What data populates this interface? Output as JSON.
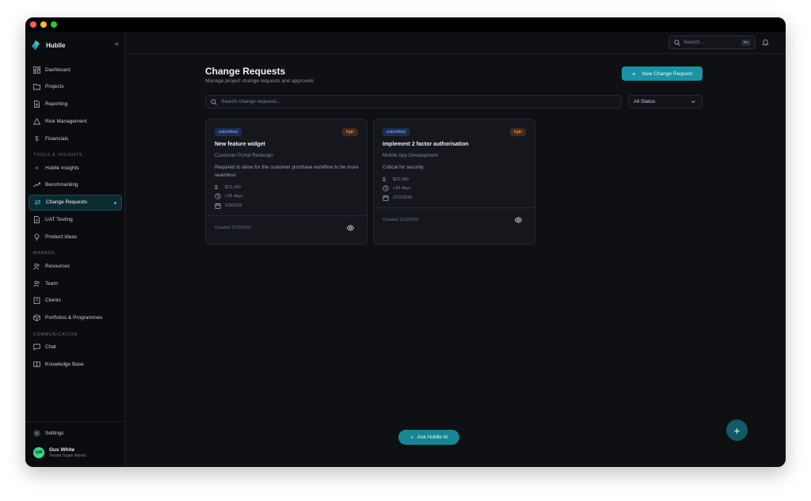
{
  "brand": {
    "name": "Hublle",
    "collapse_icon": "double-chevron-left-icon"
  },
  "sidebar": {
    "main_items": [
      {
        "label": "Dashboard",
        "icon": "layout-grid-icon"
      },
      {
        "label": "Projects",
        "icon": "folder-icon"
      },
      {
        "label": "Reporting",
        "icon": "file-text-icon"
      },
      {
        "label": "Risk Management",
        "icon": "alert-triangle-icon"
      },
      {
        "label": "Financials",
        "icon": "dollar-icon"
      }
    ],
    "tools_label": "TOOLS & INSIGHTS",
    "tools_items": [
      {
        "label": "Hublle Insights",
        "icon": "sparkles-icon"
      },
      {
        "label": "Benchmarking",
        "icon": "trending-up-icon"
      },
      {
        "label": "Change Requests",
        "icon": "arrows-swap-icon",
        "active": true
      },
      {
        "label": "UAT Testing",
        "icon": "file-check-icon"
      },
      {
        "label": "Product Ideas",
        "icon": "lightbulb-icon"
      }
    ],
    "manage_label": "MANAGE",
    "manage_items": [
      {
        "label": "Resources",
        "icon": "users-icon"
      },
      {
        "label": "Team",
        "icon": "users-icon"
      },
      {
        "label": "Clients",
        "icon": "building-icon"
      },
      {
        "label": "Portfolios & Programmes",
        "icon": "package-icon"
      }
    ],
    "communication_label": "COMMUNICATION",
    "communication_items": [
      {
        "label": "Chat",
        "icon": "message-icon"
      },
      {
        "label": "Knowledge Base",
        "icon": "book-icon"
      }
    ],
    "settings_label": "Settings",
    "user": {
      "initials": "GW",
      "name": "Gus White",
      "role": "Tenant Super Admin"
    }
  },
  "topbar": {
    "search_placeholder": "Search...",
    "shortcut": "⌘K"
  },
  "page": {
    "title": "Change Requests",
    "subtitle": "Manage project change requests and approvals",
    "new_button": "New Change Request",
    "search_placeholder": "Search change requests...",
    "status_filter": "All Status"
  },
  "cards": [
    {
      "status": "submitted",
      "priority": "high",
      "title": "New feature widget",
      "project": "Customer Portal Redesign",
      "description": "Required to allow for the customer purchase workflow to be more seamless",
      "cost": "$15,000",
      "duration": "+15 days",
      "date": "2/3/2026",
      "created": "Created 27/2/2026"
    },
    {
      "status": "submitted",
      "priority": "high",
      "title": "Implement 2 factor authorisation",
      "project": "Mobile App Development",
      "description": "Critical for security",
      "cost": "$20,000",
      "duration": "+10 days",
      "date": "27/2/2026",
      "created": "Created 11/2/2026"
    }
  ],
  "ask_ai": "Ask Hublle AI",
  "colors": {
    "accent": "#1a93a4",
    "status_badge": "#1b2f55",
    "priority_badge": "#47291a",
    "avatar": "#3ed68a"
  }
}
